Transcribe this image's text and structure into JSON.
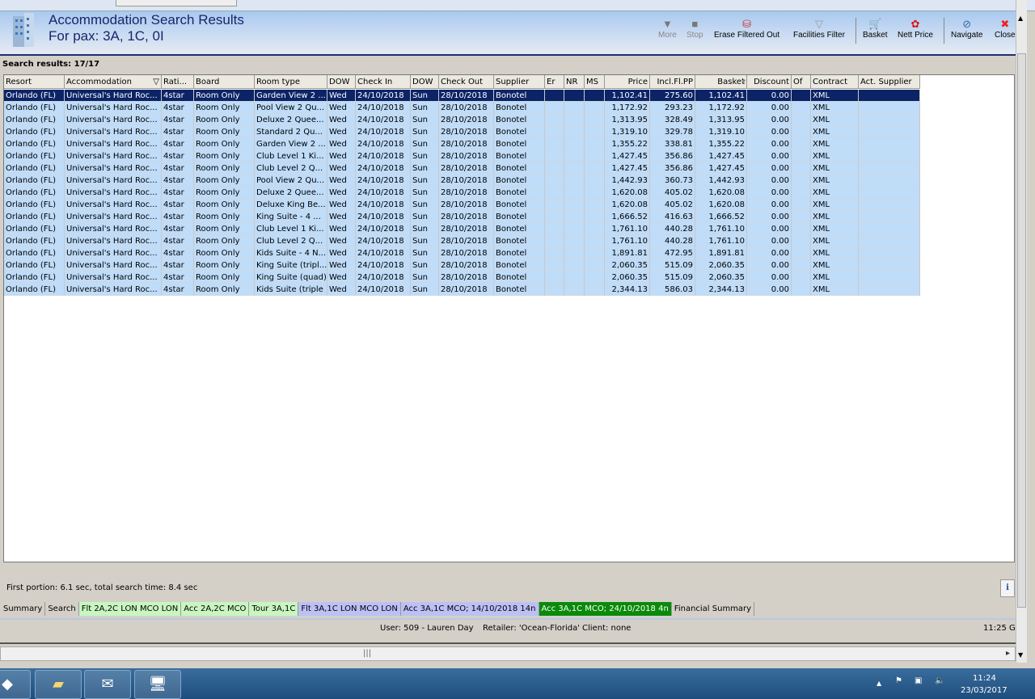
{
  "header": {
    "title": "Accommodation Search Results",
    "subtitle": "For pax: 3A, 1C, 0I"
  },
  "toolbar": [
    {
      "label": "More",
      "icon": "triangle-down-icon",
      "disabled": true
    },
    {
      "label": "Stop",
      "icon": "stop-icon",
      "disabled": true
    },
    {
      "label": "Erase Filtered Out",
      "icon": "erase-icon",
      "disabled": false
    },
    {
      "label": "Facilities Filter",
      "icon": "funnel-icon",
      "disabled": false
    },
    {
      "label": "Basket",
      "icon": "basket-icon",
      "disabled": false
    },
    {
      "label": "Nett Price",
      "icon": "nett-price-icon",
      "disabled": false
    },
    {
      "label": "Navigate",
      "icon": "compass-icon",
      "disabled": false
    },
    {
      "label": "Close",
      "icon": "close-icon",
      "disabled": false
    }
  ],
  "search_results_label": "Search results: 17/17",
  "columns": [
    "Resort",
    "Accommodation",
    "Rati...",
    "Board",
    "Room type",
    "DOW",
    "Check In",
    "DOW",
    "Check Out",
    "Supplier",
    "Er",
    "NR",
    "MS",
    "Price",
    "Incl.Fl.PP",
    "Basket",
    "Discount",
    "Of",
    "Contract",
    "Act. Supplier"
  ],
  "rows": [
    [
      "Garden View 2 ...",
      "1,102.41",
      "275.60",
      "1,102.41"
    ],
    [
      "Pool View 2 Qu...",
      "1,172.92",
      "293.23",
      "1,172.92"
    ],
    [
      "Deluxe 2 Quee...",
      "1,313.95",
      "328.49",
      "1,313.95"
    ],
    [
      "Standard 2 Qu...",
      "1,319.10",
      "329.78",
      "1,319.10"
    ],
    [
      "Garden View 2 ...",
      "1,355.22",
      "338.81",
      "1,355.22"
    ],
    [
      "Club Level 1 Ki...",
      "1,427.45",
      "356.86",
      "1,427.45"
    ],
    [
      "Club Level 2 Q...",
      "1,427.45",
      "356.86",
      "1,427.45"
    ],
    [
      "Pool View 2 Qu...",
      "1,442.93",
      "360.73",
      "1,442.93"
    ],
    [
      "Deluxe 2 Quee...",
      "1,620.08",
      "405.02",
      "1,620.08"
    ],
    [
      "Deluxe King Be...",
      "1,620.08",
      "405.02",
      "1,620.08"
    ],
    [
      "King Suite - 4 ...",
      "1,666.52",
      "416.63",
      "1,666.52"
    ],
    [
      "Club Level 1 Ki...",
      "1,761.10",
      "440.28",
      "1,761.10"
    ],
    [
      "Club Level 2 Q...",
      "1,761.10",
      "440.28",
      "1,761.10"
    ],
    [
      "Kids Suite - 4 N...",
      "1,891.81",
      "472.95",
      "1,891.81"
    ],
    [
      "King Suite (tripl...",
      "2,060.35",
      "515.09",
      "2,060.35"
    ],
    [
      "King Suite (quad)",
      "2,060.35",
      "515.09",
      "2,060.35"
    ],
    [
      "Kids Suite (triple )",
      "2,344.13",
      "586.03",
      "2,344.13"
    ]
  ],
  "row_common": {
    "resort": "Orlando (FL)",
    "accommodation": "Universal's Hard Roc...",
    "rating": "4star",
    "board": "Room Only",
    "dow_in": "Wed",
    "check_in": "24/10/2018",
    "dow_out": "Sun",
    "check_out": "28/10/2018",
    "supplier": "Bonotel",
    "discount": "0.00",
    "contract": "XML"
  },
  "footer": {
    "timing": "First portion: 6.1 sec, total search time: 8.4 sec",
    "info": "i"
  },
  "tabs": [
    {
      "label": "Summary",
      "color": "#d4d0c8"
    },
    {
      "label": "Search",
      "color": "#d4d0c8"
    },
    {
      "label": "Flt 2A,2C LON MCO LON",
      "color": "#c8f5c0"
    },
    {
      "label": "Acc 2A,2C MCO",
      "color": "#c8f5c0"
    },
    {
      "label": "Tour 3A,1C",
      "color": "#c8f5c0"
    },
    {
      "label": "Flt 3A,1C LON MCO LON",
      "color": "#bcc0f5"
    },
    {
      "label": "Acc 3A,1C MCO; 14/10/2018 14n",
      "color": "#bcc0f5"
    },
    {
      "label": "Acc 3A,1C MCO; 24/10/2018 4n",
      "color": "#0a8a0a"
    },
    {
      "label": "Financial Summary",
      "color": "#d4d0c8"
    }
  ],
  "status": {
    "user": "User: 509 - Lauren Day",
    "retailer": "Retailer: 'Ocean-Florida'",
    "client": "Client: none",
    "time": "11:25 G"
  },
  "taskbar": {
    "time": "11:24",
    "date": "23/03/2017"
  }
}
